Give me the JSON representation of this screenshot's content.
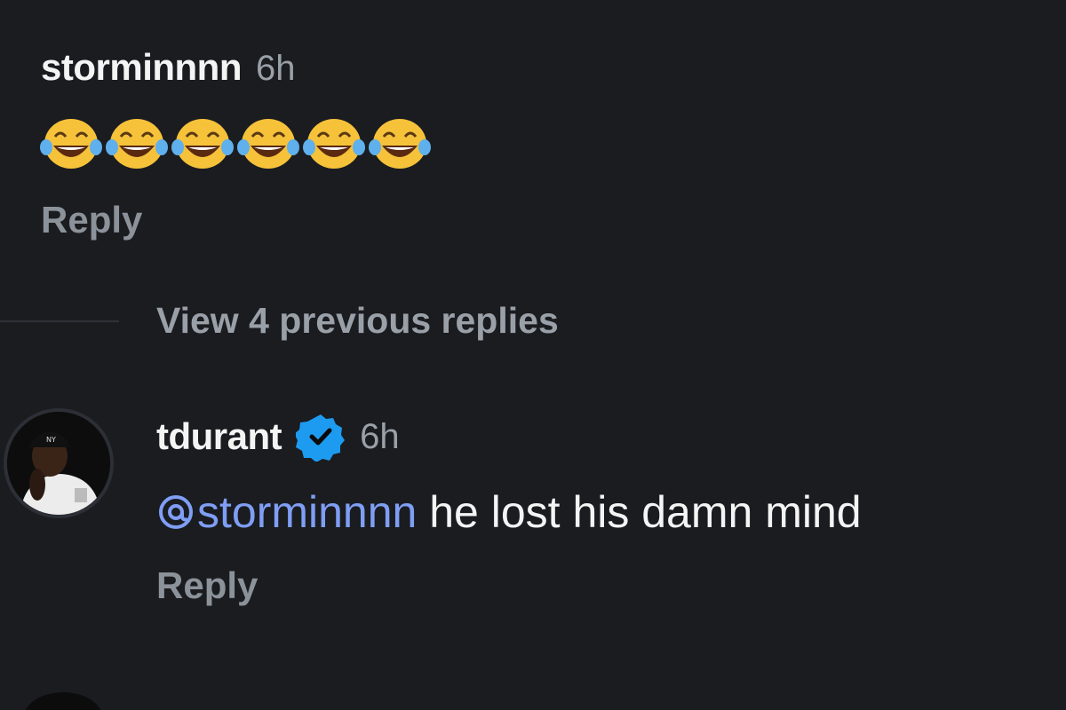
{
  "comments": [
    {
      "username": "storminnnn",
      "time": "6h",
      "emojis": [
        "face-with-tears-of-joy",
        "face-with-tears-of-joy",
        "face-with-tears-of-joy",
        "face-with-tears-of-joy",
        "face-with-tears-of-joy",
        "face-with-tears-of-joy"
      ],
      "reply_label": "Reply"
    }
  ],
  "thread": {
    "view_previous_label": "View 4 previous replies"
  },
  "reply": {
    "username": "tdurant",
    "verified": true,
    "time": "6h",
    "mention": "storminnnn",
    "text": " he lost his damn mind",
    "reply_label": "Reply",
    "avatar_icon": "profile-photo"
  },
  "colors": {
    "background": "#1a1c20",
    "mention": "#7f9ef4",
    "verified_badge": "#1d9bf0",
    "muted": "#9aa0a8"
  }
}
